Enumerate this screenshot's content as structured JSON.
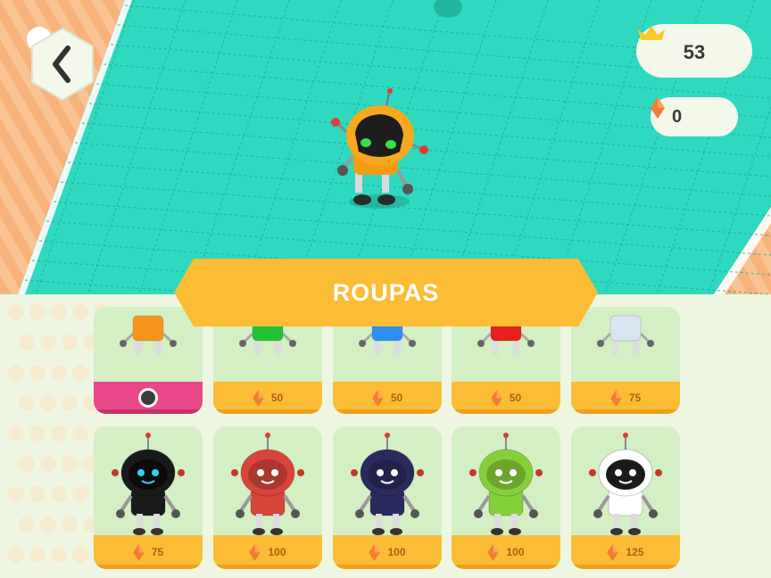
{
  "hud": {
    "back_icon": "chevron-left-icon",
    "crowns": "53",
    "gems": "0"
  },
  "shop": {
    "title": "ROUPAS",
    "items": [
      {
        "color": "#f7931e",
        "price": "",
        "equipped": true
      },
      {
        "color": "#22c13a",
        "price": "50"
      },
      {
        "color": "#2e8ff0",
        "price": "50"
      },
      {
        "color": "#e8201f",
        "price": "50"
      },
      {
        "color": "#d8e6f2",
        "price": "75"
      },
      {
        "color": "#1a1a1a",
        "price": "75"
      },
      {
        "color": "#d8453a",
        "price": "100"
      },
      {
        "color": "#2b2a5e",
        "price": "100"
      },
      {
        "color": "#86cf3c",
        "price": "100"
      },
      {
        "color": "#ffffff",
        "price": "125"
      }
    ]
  },
  "colors": {
    "floor": "#2fd9bf",
    "accent": "#fbbd35",
    "selected": "#e8488a"
  }
}
